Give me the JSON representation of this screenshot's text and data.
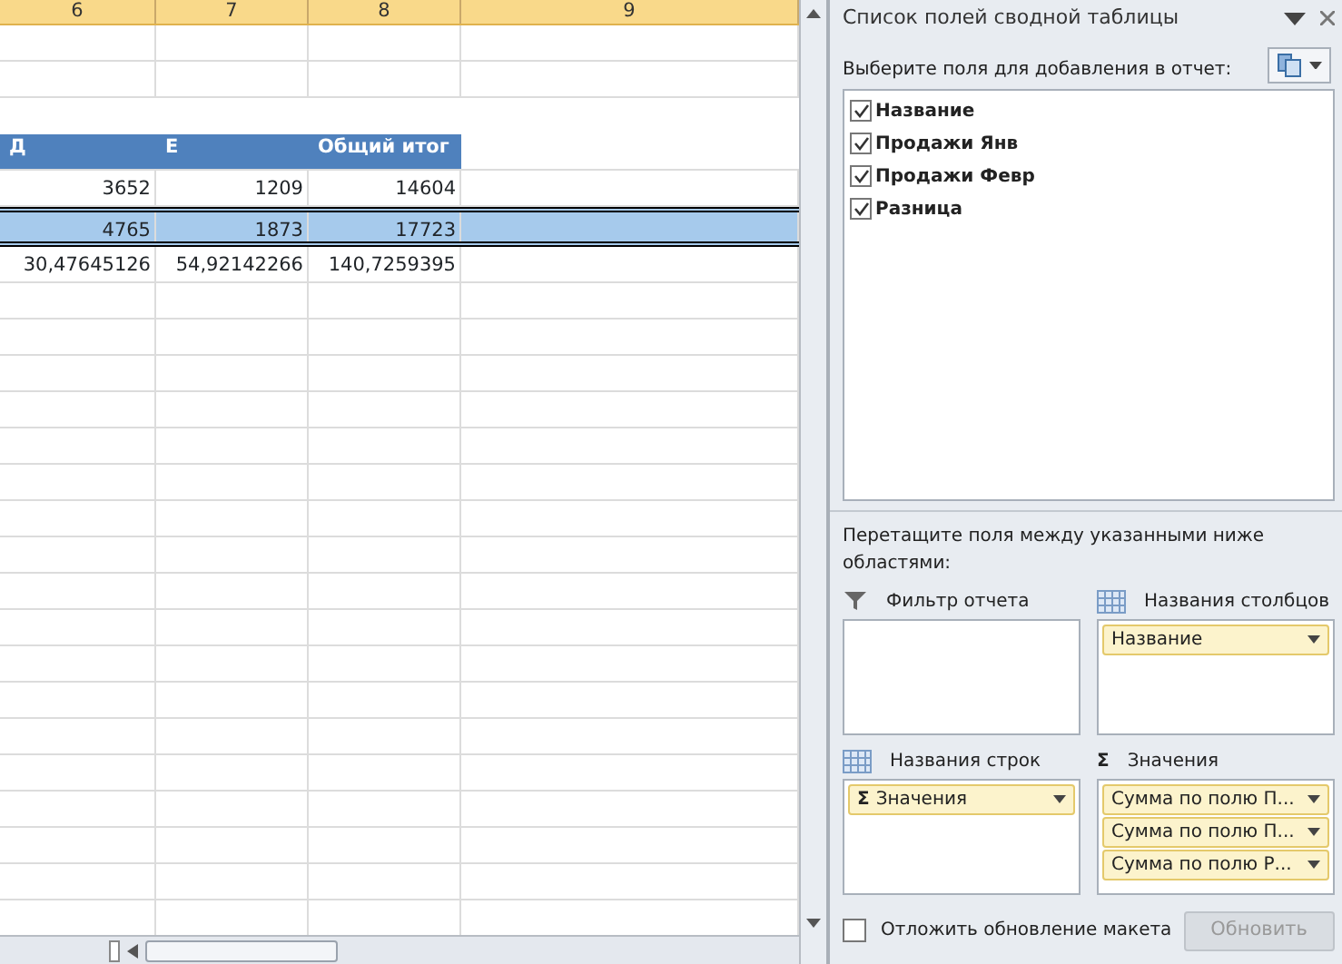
{
  "sheet": {
    "columns": [
      "6",
      "7",
      "8",
      "9"
    ],
    "pivot_header": [
      "Д",
      "Е",
      "Общий итог"
    ],
    "rows": [
      {
        "cells": [
          "3652",
          "1209",
          "14604"
        ],
        "selected": false
      },
      {
        "cells": [
          "4765",
          "1873",
          "17723"
        ],
        "selected": true
      },
      {
        "cells": [
          "30,47645126",
          "54,92142266",
          "140,7259395"
        ],
        "selected": false
      }
    ]
  },
  "panel": {
    "title": "Список полей сводной таблицы",
    "field_prompt": "Выберите поля для добавления в отчет:",
    "fields": [
      {
        "label": "Название",
        "checked": true
      },
      {
        "label": "Продажи Янв",
        "checked": true
      },
      {
        "label": "Продажи Февр",
        "checked": true
      },
      {
        "label": "Разница",
        "checked": true
      }
    ],
    "drag_prompt": "Перетащите поля между указанными ниже областями:",
    "areas": [
      {
        "kind": "filter",
        "label": "Фильтр отчета"
      },
      {
        "kind": "columns",
        "label": "Названия столбцов",
        "items": [
          {
            "label": "Название"
          }
        ]
      },
      {
        "kind": "rows",
        "label": "Названия строк",
        "items": [
          {
            "label": "Значения",
            "symbol": "Σ"
          }
        ]
      },
      {
        "kind": "values",
        "label": "Значения",
        "symbol": "Σ",
        "items": [
          {
            "label": "Сумма по полю П..."
          },
          {
            "label": "Сумма по полю П..."
          },
          {
            "label": "Сумма по полю Р..."
          }
        ]
      }
    ],
    "defer": {
      "label": "Отложить обновление макета",
      "checked": false
    },
    "update_button": {
      "label": "Обновить",
      "disabled": true
    }
  }
}
